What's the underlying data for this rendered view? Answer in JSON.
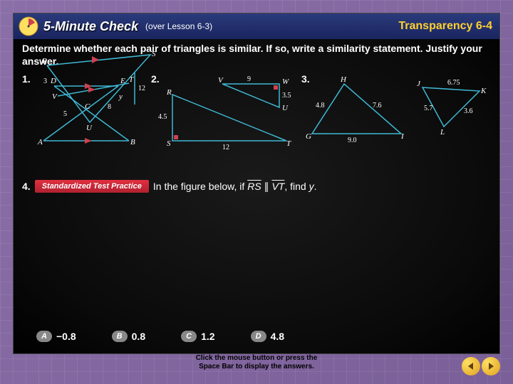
{
  "header": {
    "title": "5-Minute Check",
    "subtitle": "(over Lesson 6-3)",
    "right": "Transparency 6-4"
  },
  "prompt": "Determine whether each pair of triangles is similar. If so, write a similarity statement. Justify your answer.",
  "problems": {
    "p1": {
      "num": "1.",
      "labels": {
        "D": "D",
        "E": "E",
        "C": "C",
        "A": "A",
        "B": "B"
      }
    },
    "p2": {
      "num": "2.",
      "labels": {
        "R": "R",
        "V": "V",
        "W": "W",
        "U": "U",
        "S": "S",
        "T": "T"
      },
      "vals": {
        "VW": "9",
        "WU": "3.5",
        "RS": "4.5",
        "ST": "12"
      }
    },
    "p3": {
      "num": "3.",
      "labels": {
        "H": "H",
        "J": "J",
        "K": "K",
        "G": "G",
        "I": "I",
        "L": "L"
      },
      "vals": {
        "HG": "4.8",
        "HI": "7.6",
        "GI": "9.0",
        "JK": "6.75",
        "JL": "5.7",
        "KL": "3.6"
      }
    }
  },
  "p4": {
    "num": "4.",
    "badge": "Standardized Test Practice",
    "text_pre": "In the figure below, if ",
    "seg1": "RS",
    "parallel": " ∥ ",
    "seg2": "VT",
    "text_post": ", find ",
    "var": "y",
    "period": ".",
    "labels": {
      "R": "R",
      "S": "S",
      "T": "T",
      "V": "V",
      "U": "U"
    },
    "vals": {
      "RV": "3",
      "VU": "5",
      "UT": "8",
      "TS": "12",
      "y": "y"
    }
  },
  "choices": {
    "A": {
      "letter": "A",
      "val": "−0.8"
    },
    "B": {
      "letter": "B",
      "val": "0.8"
    },
    "C": {
      "letter": "C",
      "val": "1.2"
    },
    "D": {
      "letter": "D",
      "val": "4.8"
    }
  },
  "footer": {
    "line1": "Click the mouse button or press the",
    "line2": "Space Bar to display the answers."
  }
}
